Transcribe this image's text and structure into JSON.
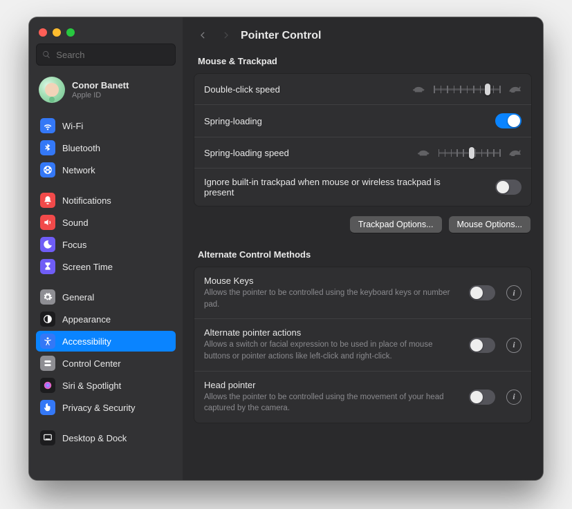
{
  "window": {
    "title": "Pointer Control"
  },
  "search": {
    "placeholder": "Search"
  },
  "user": {
    "name": "Conor Banett",
    "subtitle": "Apple ID"
  },
  "sidebar": [
    {
      "label": "Wi-Fi",
      "icon": "wifi",
      "color": "#3478f6"
    },
    {
      "label": "Bluetooth",
      "icon": "bluetooth",
      "color": "#3478f6"
    },
    {
      "label": "Network",
      "icon": "network",
      "color": "#3478f6"
    },
    {
      "spacer": true
    },
    {
      "label": "Notifications",
      "icon": "bell",
      "color": "#f14a4a"
    },
    {
      "label": "Sound",
      "icon": "sound",
      "color": "#f14a4a"
    },
    {
      "label": "Focus",
      "icon": "moon",
      "color": "#6f5df6"
    },
    {
      "label": "Screen Time",
      "icon": "hourglass",
      "color": "#6f5df6"
    },
    {
      "spacer": true
    },
    {
      "label": "General",
      "icon": "gear",
      "color": "#8e8e93"
    },
    {
      "label": "Appearance",
      "icon": "appearance",
      "color": "#1c1c1e"
    },
    {
      "label": "Accessibility",
      "icon": "accessibility",
      "color": "#3478f6",
      "selected": true
    },
    {
      "label": "Control Center",
      "icon": "controls",
      "color": "#8e8e93"
    },
    {
      "label": "Siri & Spotlight",
      "icon": "siri",
      "color": "#1c1c1e"
    },
    {
      "label": "Privacy & Security",
      "icon": "hand",
      "color": "#3478f6"
    },
    {
      "spacer": true
    },
    {
      "label": "Desktop & Dock",
      "icon": "dock",
      "color": "#1c1c1e"
    }
  ],
  "sections": {
    "mouse_trackpad": {
      "title": "Mouse & Trackpad",
      "double_click": {
        "label": "Double-click speed",
        "value": 0.82
      },
      "spring_loading": {
        "label": "Spring-loading",
        "on": true
      },
      "spring_speed": {
        "label": "Spring-loading speed",
        "value": 0.55
      },
      "ignore_trackpad": {
        "label": "Ignore built-in trackpad when mouse or wireless trackpad is present",
        "on": false
      },
      "buttons": {
        "trackpad": "Trackpad Options...",
        "mouse": "Mouse Options..."
      }
    },
    "alt_methods": {
      "title": "Alternate Control Methods",
      "mouse_keys": {
        "label": "Mouse Keys",
        "desc": "Allows the pointer to be controlled using the keyboard keys or number pad.",
        "on": false
      },
      "alt_pointer": {
        "label": "Alternate pointer actions",
        "desc": "Allows a switch or facial expression to be used in place of mouse buttons or pointer actions like left-click and right-click.",
        "on": false
      },
      "head_pointer": {
        "label": "Head pointer",
        "desc": "Allows the pointer to be controlled using the movement of your head captured by the camera.",
        "on": false
      }
    }
  }
}
